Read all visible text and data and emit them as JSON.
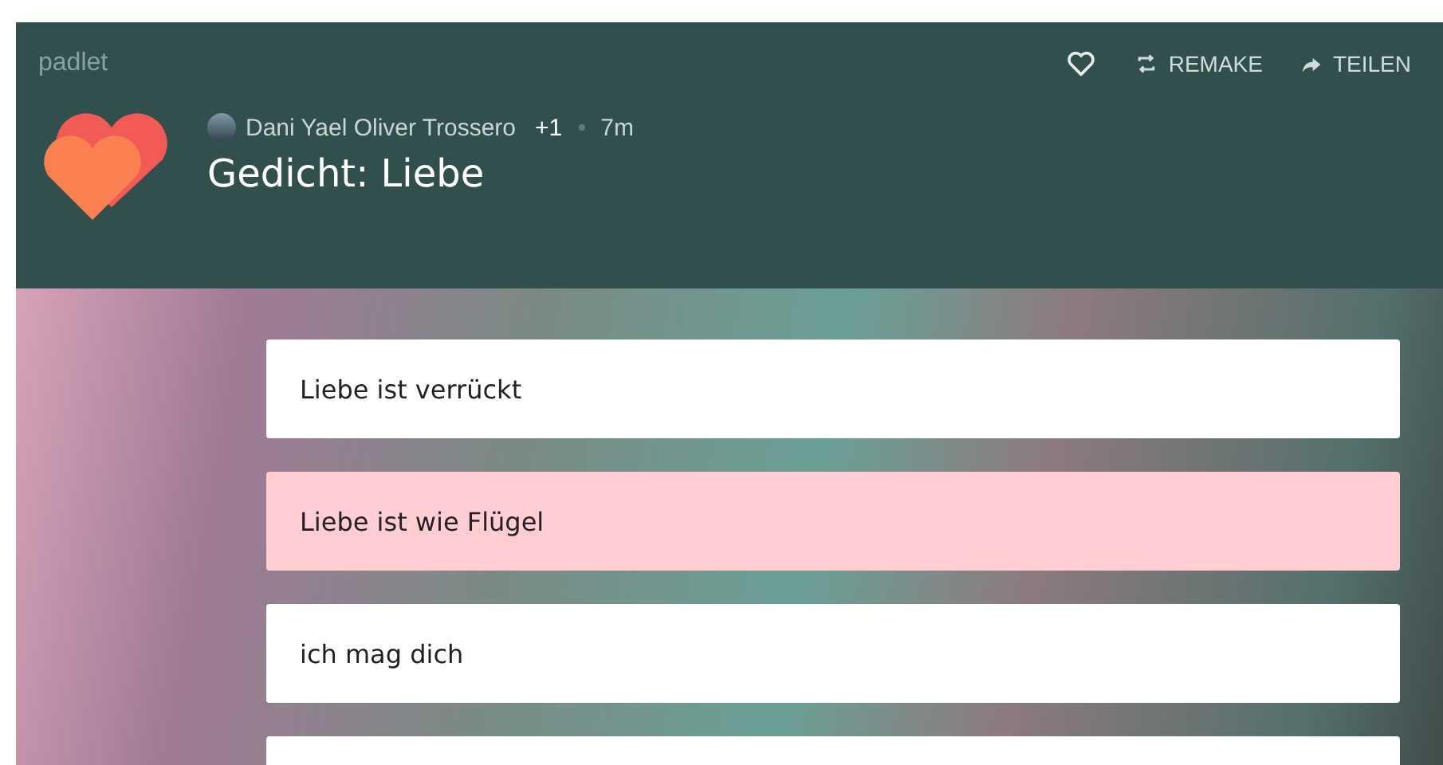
{
  "brand": "padlet",
  "actions": [
    {
      "label": "REMAKE",
      "kind": "remake"
    },
    {
      "label": "TEILEN",
      "kind": "share"
    }
  ],
  "author": {
    "name": "Dani Yael Oliver Trossero",
    "extra": "+1",
    "time": "7m"
  },
  "title": "Gedicht: Liebe",
  "posts": [
    {
      "text": "Liebe ist verrückt",
      "color": "#ffffff"
    },
    {
      "text": "Liebe ist wie Flügel",
      "color": "#ffcdd2"
    },
    {
      "text": "ich mag dich",
      "color": "#ffffff"
    },
    {
      "color": "#ffffff"
    }
  ]
}
